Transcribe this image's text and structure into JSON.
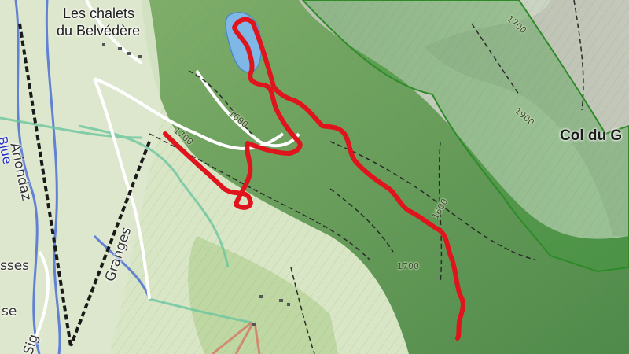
{
  "map": {
    "labels": {
      "place_line1": "Les chalets",
      "place_line2": "du Belvédère",
      "pass_name": "Col du G",
      "street_ariondaz": "Ariondaz",
      "street_granges": "Granges",
      "piste_blue": "Blue",
      "fragment_sses": "sses",
      "fragment_se": "se",
      "fragment_sig": "Sig",
      "contour_1700_a": "1700",
      "contour_1600_a": "1600",
      "contour_1700_b": "1700",
      "contour_1900": "1900",
      "contour_1600_b": "1600",
      "contour_1700_c": "1700"
    },
    "colors": {
      "route": "#e0141c",
      "protected_area": "#2f8a2a",
      "piste_blue": "#2e56d8",
      "ski_path_green": "#6cc6a0",
      "lift": "#1a1a1a"
    }
  }
}
